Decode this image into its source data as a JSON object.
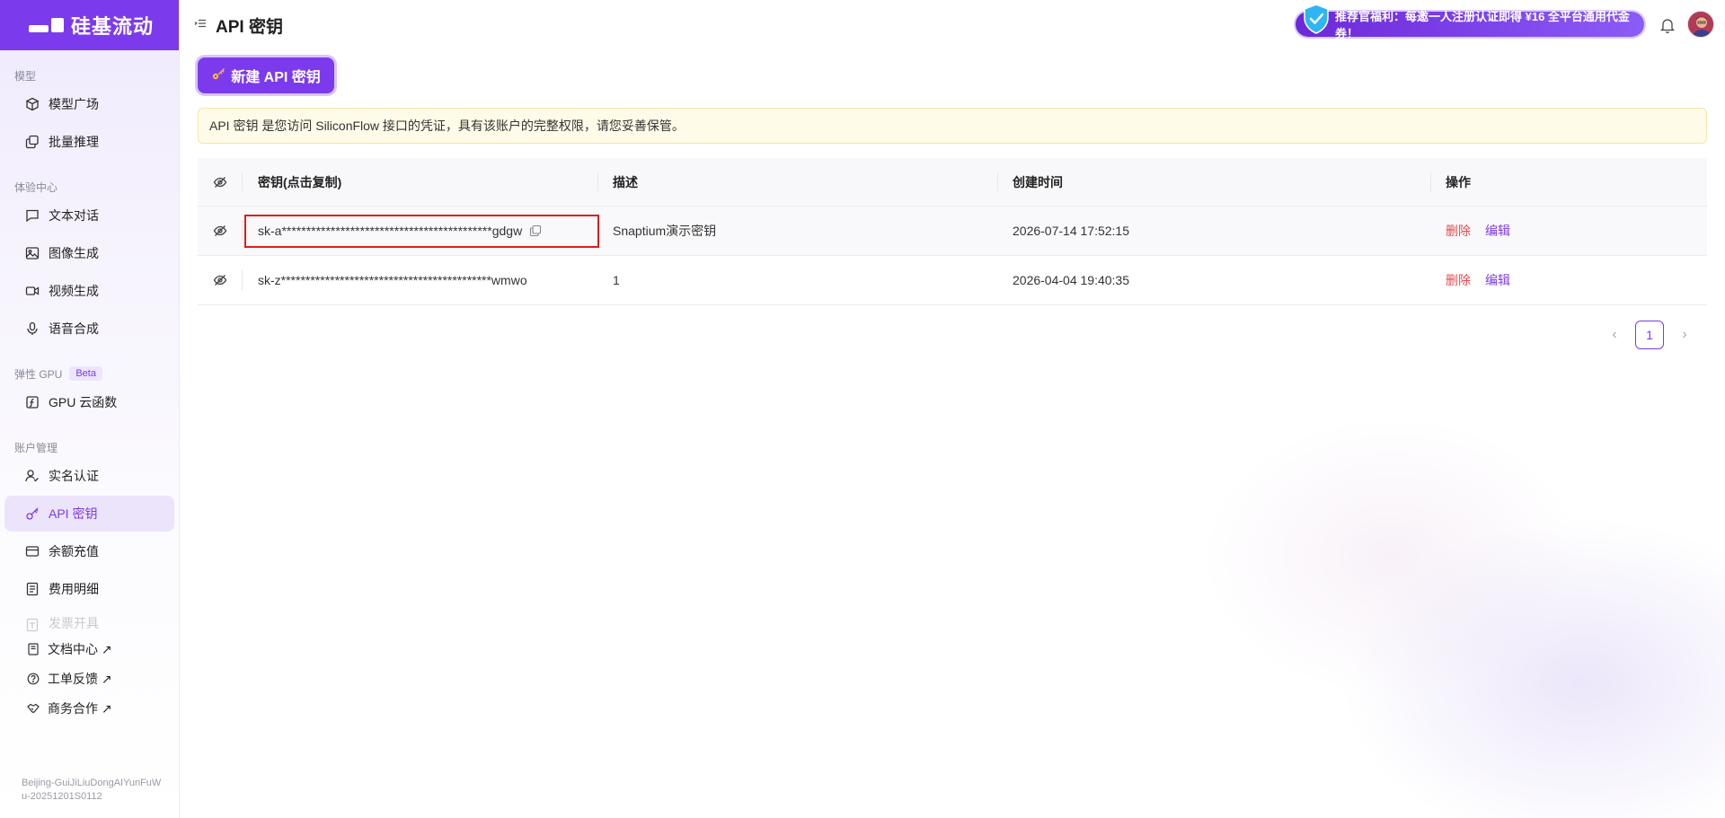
{
  "brand": {
    "name": "硅基流动"
  },
  "sidebar": {
    "sections": [
      {
        "title": "模型",
        "items": [
          {
            "label": "模型广场",
            "icon": "cube-icon"
          },
          {
            "label": "批量推理",
            "icon": "copy-stack-icon"
          }
        ]
      },
      {
        "title": "体验中心",
        "items": [
          {
            "label": "文本对话",
            "icon": "chat-icon"
          },
          {
            "label": "图像生成",
            "icon": "image-icon"
          },
          {
            "label": "视频生成",
            "icon": "video-icon"
          },
          {
            "label": "语音合成",
            "icon": "mic-icon"
          }
        ]
      },
      {
        "title": "弹性 GPU",
        "badge": "Beta",
        "items": [
          {
            "label": "GPU 云函数",
            "icon": "function-icon"
          }
        ]
      },
      {
        "title": "账户管理",
        "items": [
          {
            "label": "实名认证",
            "icon": "user-check-icon"
          },
          {
            "label": "API 密钥",
            "icon": "key-icon",
            "active": true
          },
          {
            "label": "余额充值",
            "icon": "card-icon"
          },
          {
            "label": "费用明细",
            "icon": "receipt-icon"
          },
          {
            "label": "发票开具",
            "icon": "invoice-icon"
          }
        ]
      }
    ],
    "links": [
      {
        "label": "文档中心 ↗",
        "icon": "book-icon"
      },
      {
        "label": "工单反馈 ↗",
        "icon": "help-circle-icon"
      },
      {
        "label": "商务合作 ↗",
        "icon": "handshake-icon"
      }
    ],
    "build": "Beijing-GuiJiLiuDongAIYunFuWu-20251201S0112"
  },
  "header": {
    "title": "API 密钥",
    "promo": "推荐官福利：每邀一人注册认证即得 ¥16 全平台通用代金券！"
  },
  "main": {
    "new_button": "新建 API 密钥",
    "notice": "API 密钥 是您访问 SiliconFlow 接口的凭证，具有该账户的完整权限，请您妥善保管。",
    "table": {
      "headers": [
        "密钥(点击复制)",
        "描述",
        "创建时间",
        "操作"
      ],
      "rows": [
        {
          "key": "sk-a*******************************************gdgw",
          "desc": "Snaptium演示密钥",
          "created": "2026-07-14 17:52:15",
          "delete": "删除",
          "edit": "编辑"
        },
        {
          "key": "sk-z*******************************************wmwo",
          "desc": "1",
          "created": "2026-04-04 19:40:35",
          "delete": "删除",
          "edit": "编辑"
        }
      ]
    },
    "pagination": {
      "current": "1",
      "prev": "‹",
      "next": "›"
    }
  },
  "colors": {
    "accent": "#7c3aed",
    "danger": "#e5484d",
    "highlight_border": "#e01b1b"
  }
}
